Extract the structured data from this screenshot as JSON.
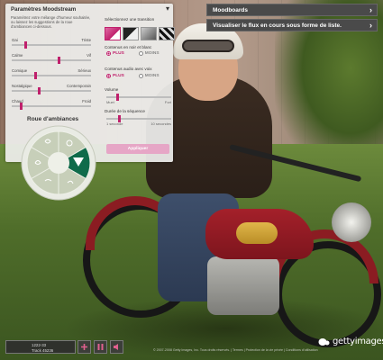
{
  "topbar": {
    "moodboards_label": "Moodboards",
    "list_view_label": "Visualiser le flux en cours sous forme de liste."
  },
  "panel": {
    "title": "Paramètres Moodstream",
    "description": "Paramétrez votre mélange d'humeur souhaitée, ou laissez les suggestions de la roue d'ambiances ci-dessous.",
    "sliders": [
      {
        "left": "Gai",
        "right": "Triste",
        "value": 0.18
      },
      {
        "left": "Calme",
        "right": "Vif",
        "value": 0.6
      },
      {
        "left": "Comique",
        "right": "Sérieux",
        "value": 0.3
      },
      {
        "left": "Nostalgique",
        "right": "Contemporain",
        "value": 0.35
      },
      {
        "left": "Chaud",
        "right": "Froid",
        "value": 0.12
      }
    ],
    "wheel_title": "Roue d'ambiances",
    "transition_label": "Sélectionnez une transition",
    "bw_label": "Contenus en noir et blanc",
    "bw_plus": "PLUS",
    "bw_moins": "MOINS",
    "audio_label": "Contenus audio avec voix",
    "audio_plus": "PLUS",
    "audio_moins": "MOINS",
    "volume_label": "Volume",
    "volume_low": "Muet",
    "volume_high": "Fort",
    "volume_value": 0.18,
    "duration_label": "Durée de la séquence",
    "duration_low": "1 seconde",
    "duration_high": "10 secondes",
    "duration_value": 0.2,
    "apply_label": "Appliquer"
  },
  "player": {
    "line1": "1222-33",
    "line2": "Track 45236"
  },
  "footer": {
    "copyright": "© 2007-2008 Getty Images, Inc. Tous droits réservés. | Termes | Protection de la vie privée | Conditions d'utilisation",
    "logo_text": "gettyimages"
  },
  "colors": {
    "accent": "#c0206c",
    "panel_bg": "#eeeeec",
    "topbar_bg": "#4a4a4a",
    "wheel_active": "#0f6b4a"
  },
  "icons": {
    "close": "chevron-down-icon",
    "topbar": "chevron-right-icon",
    "plus": "plus-icon",
    "pause": "pause-icon",
    "volume": "speaker-icon"
  }
}
